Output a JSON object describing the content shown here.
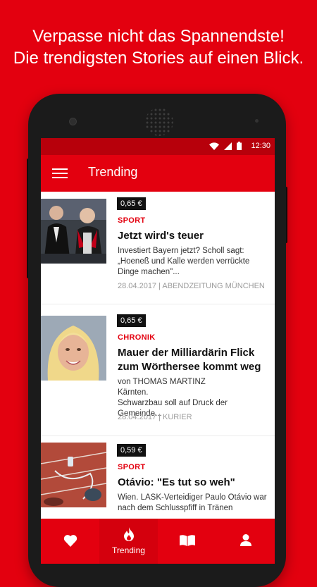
{
  "promo": {
    "line1": "Verpasse nicht das Spannendste!",
    "line2": "Die trendigsten Stories auf einen Blick."
  },
  "status_bar": {
    "time": "12:30",
    "icons": [
      "wifi-icon",
      "signal-icon",
      "battery-icon"
    ]
  },
  "app_bar": {
    "title": "Trending",
    "menu_icon": "hamburger-menu-icon"
  },
  "colors": {
    "brand_red": "#e3000f",
    "status_red": "#b7000b",
    "price_badge": "#111111",
    "meta_grey": "#9b9b9b"
  },
  "articles": [
    {
      "price": "0,65 €",
      "category": "SPORT",
      "title": "Jetzt wird's teuer",
      "body": "Investiert Bayern jetzt? Scholl sagt: „Hoeneß und Kalle werden verrückte Dinge machen\"...",
      "meta": "28.04.2017 | ABENDZEITUNG MÜNCHEN"
    },
    {
      "price": "0,65 €",
      "category": "CHRONIK",
      "title": "Mauer der Milliardärin Flick zum Wörthersee kommt weg",
      "author": "von THOMAS MARTINZ",
      "body_line1": "Kärnten.",
      "body_line2": "Schwarzbau soll auf Druck der Gemeinde...",
      "meta": "28.04.2017 | KURIER"
    },
    {
      "price": "0,59 €",
      "category": "SPORT",
      "title": "Otávio: \"Es tut so weh\"",
      "body": "Wien. LASK-Verteidiger Paulo Otávio war nach dem Schlusspfiff in Tränen"
    }
  ],
  "bottom_nav": {
    "items": [
      {
        "icon": "heart-icon",
        "label": ""
      },
      {
        "icon": "flame-icon",
        "label": "Trending"
      },
      {
        "icon": "book-icon",
        "label": ""
      },
      {
        "icon": "person-icon",
        "label": ""
      }
    ],
    "active": "Trending"
  }
}
